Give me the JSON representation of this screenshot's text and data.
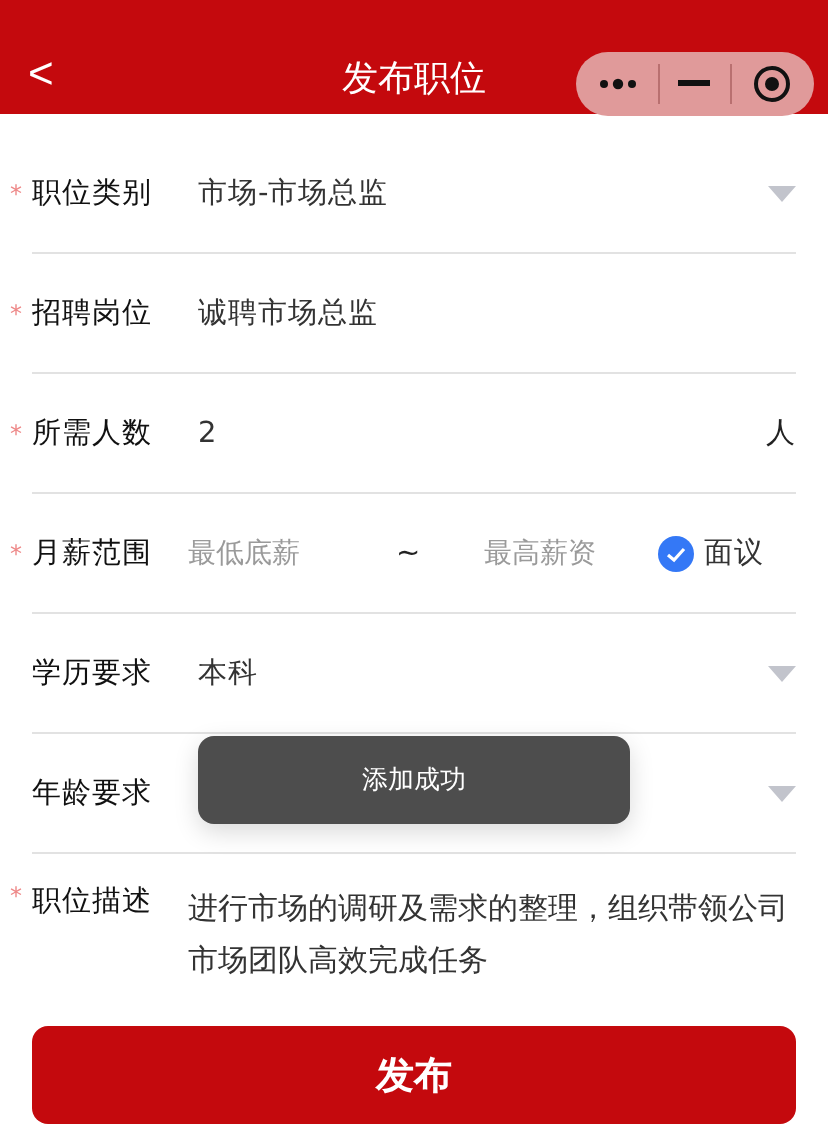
{
  "header": {
    "back": "<",
    "title": "发布职位"
  },
  "form": [
    {
      "kind": "select",
      "asterisk": "*",
      "label": "职位类别",
      "value": "市场-市场总监"
    },
    {
      "kind": "text",
      "asterisk": "*",
      "label": "招聘岗位",
      "value": "诚聘市场总监"
    },
    {
      "kind": "unit",
      "asterisk": "*",
      "label": "所需人数",
      "value": "2",
      "unit": "人"
    },
    {
      "kind": "range",
      "asterisk": "*",
      "label": "月薪范围",
      "min_placeholder": "最低底薪",
      "separator": "~",
      "max_placeholder": "最高薪资",
      "negotiable": {
        "label": "面议",
        "checked": true
      }
    },
    {
      "kind": "select",
      "label": "学历要求",
      "value": "本科"
    },
    {
      "kind": "select",
      "label": "年龄要求"
    },
    {
      "kind": "textarea",
      "asterisk": "*",
      "label": "职位描述",
      "value": "进行市场的调研及需求的整理，组织带领公司市场团队高效完成任务"
    }
  ],
  "toast": "添加成功",
  "submit": "发布"
}
